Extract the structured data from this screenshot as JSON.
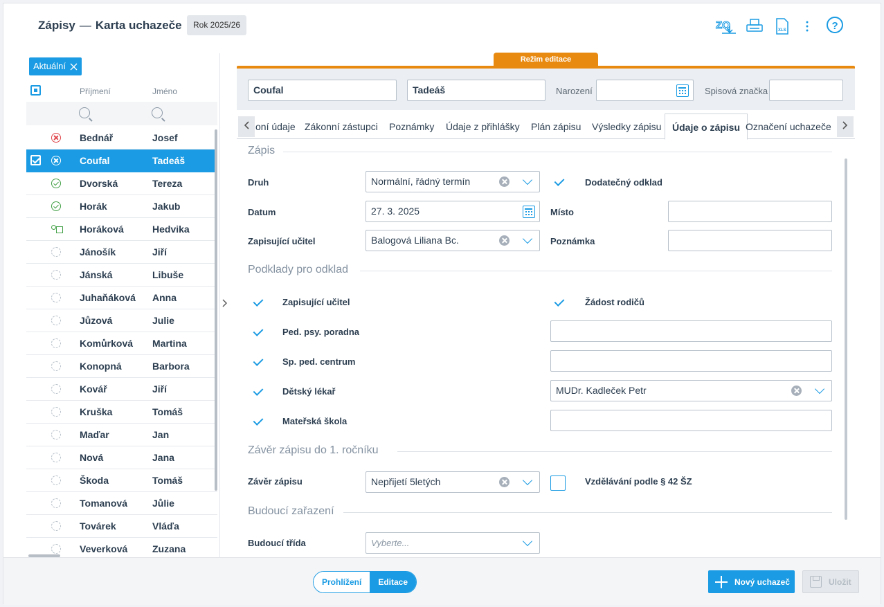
{
  "header": {
    "section": "Zápisy",
    "separator": "—",
    "page": "Karta uchazeče",
    "year_badge": "Rok 2025/26",
    "icons": [
      "zq-download-icon",
      "print-icon",
      "xls-export-icon",
      "more-vert-icon",
      "help-icon"
    ],
    "zq_label": "ZQ",
    "xls_label": "XLS",
    "help_label": "?"
  },
  "list": {
    "filter_chip": "Aktuální",
    "col_surname": "Příjmení",
    "col_name": "Jméno",
    "rows": [
      {
        "surname": "Bednář",
        "name": "Josef",
        "status": "err"
      },
      {
        "surname": "Coufal",
        "name": "Tadeáš",
        "status": "err",
        "selected": true
      },
      {
        "surname": "Dvorská",
        "name": "Tereza",
        "status": "ok"
      },
      {
        "surname": "Horák",
        "name": "Jakub",
        "status": "ok"
      },
      {
        "surname": "Horáková",
        "name": "Hedvika",
        "status": "card"
      },
      {
        "surname": "Jánošík",
        "name": "Jiří",
        "status": "dot"
      },
      {
        "surname": "Jánská",
        "name": "Libuše",
        "status": "dot"
      },
      {
        "surname": "Juhaňáková",
        "name": "Anna",
        "status": "dot"
      },
      {
        "surname": "Jůzová",
        "name": "Julie",
        "status": "dot"
      },
      {
        "surname": "Komůrková",
        "name": "Martina",
        "status": "dot"
      },
      {
        "surname": "Konopná",
        "name": "Barbora",
        "status": "dot"
      },
      {
        "surname": "Kovář",
        "name": "Jiří",
        "status": "dot"
      },
      {
        "surname": "Kruška",
        "name": "Tomáš",
        "status": "dot"
      },
      {
        "surname": "Maďar",
        "name": "Jan",
        "status": "dot"
      },
      {
        "surname": "Nová",
        "name": "Jana",
        "status": "dot"
      },
      {
        "surname": "Škoda",
        "name": "Tomáš",
        "status": "dot"
      },
      {
        "surname": "Tomanová",
        "name": "Jůlie",
        "status": "dot"
      },
      {
        "surname": "Továrek",
        "name": "Vláďa",
        "status": "dot"
      },
      {
        "surname": "Veverková",
        "name": "Zuzana",
        "status": "dot"
      }
    ]
  },
  "edit_mode": "Režim editace",
  "idbar": {
    "surname": "Coufal",
    "name": "Tadeáš",
    "birth_label": "Narození",
    "birth_value": "",
    "file_label": "Spisová značka",
    "file_value": ""
  },
  "tabs": [
    "oní údaje",
    "Zákonní zástupci",
    "Poznámky",
    "Údaje z přihlášky",
    "Plán zápisu",
    "Výsledky zápisu",
    "Údaje o zápisu",
    "Označení uchazeče"
  ],
  "active_tab": "Údaje o zápisu",
  "zapis": {
    "title": "Zápis",
    "druh_label": "Druh",
    "druh_value": "Normální, řádný termín",
    "dodatecny_label": "Dodatečný odklad",
    "datum_label": "Datum",
    "datum_value": "27. 3. 2025",
    "misto_label": "Místo",
    "misto_value": "",
    "ucitel_label": "Zapisující učitel",
    "ucitel_value": "Balogová Liliana Bc.",
    "poznamka_label": "Poznámka",
    "poznamka_value": ""
  },
  "podklady": {
    "title": "Podklady pro odklad",
    "items_left": [
      "Zapisující učitel",
      "Ped. psy. poradna",
      "Sp. ped. centrum",
      "Dětský lékař",
      "Mateřská škola"
    ],
    "zadost": "Žádost rodičů",
    "lekar_value": "MUDr. Kadleček Petr"
  },
  "zaver": {
    "title": "Závěr zápisu do 1. ročníku",
    "label": "Závěr zápisu",
    "value": "Nepřijetí 5letých",
    "checkbox_label": "Vzdělávání podle § 42 ŠZ"
  },
  "budouci": {
    "title": "Budoucí zařazení",
    "label": "Budoucí třída",
    "placeholder": "Vyberte..."
  },
  "footer": {
    "view": "Prohlížení",
    "edit": "Editace",
    "new": "Nový uchazeč",
    "save": "Uložit"
  },
  "colors": {
    "accent": "#1a9be3",
    "edit_mode": "#e98a10"
  }
}
